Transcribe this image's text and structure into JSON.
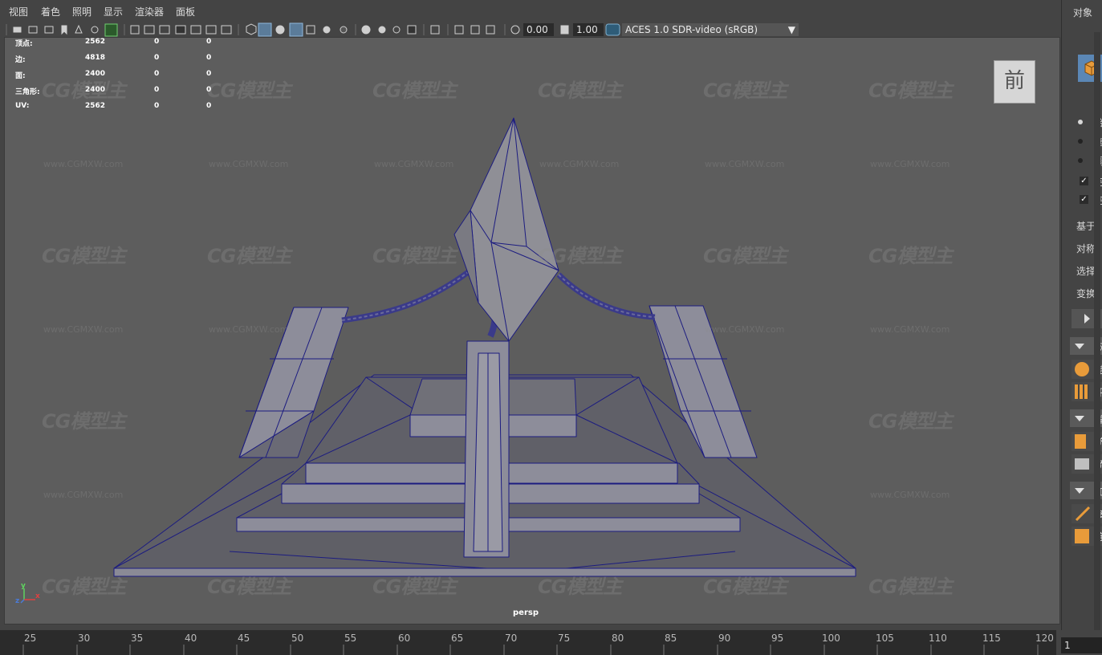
{
  "menu": [
    "视图",
    "着色",
    "照明",
    "显示",
    "渲染器",
    "面板"
  ],
  "toolbar": {
    "exposure_value": "0.00",
    "gamma_value": "1.00",
    "color_space": "ACES 1.0 SDR-video (sRGB)"
  },
  "hud": {
    "rows": [
      {
        "label": "顶点:",
        "v1": "2562",
        "v2": "0",
        "v3": "0"
      },
      {
        "label": "边:",
        "v1": "4818",
        "v2": "0",
        "v3": "0"
      },
      {
        "label": "面:",
        "v1": "2400",
        "v2": "0",
        "v3": "0"
      },
      {
        "label": "三角形:",
        "v1": "2400",
        "v2": "0",
        "v3": "0"
      },
      {
        "label": "UV:",
        "v1": "2562",
        "v2": "0",
        "v3": "0"
      }
    ]
  },
  "viewport": {
    "camera_label": "persp",
    "viewcube_face": "前",
    "axis_labels": {
      "y": "y",
      "x": "x",
      "z": "z"
    },
    "background_color": "#5d5d5d",
    "wire_color": "#1a1a7a",
    "mesh_color": "#8d8d9a"
  },
  "watermark": {
    "logo": "CG模型主",
    "url": "www.CGMXW.com"
  },
  "timeline": {
    "ticks": [
      "25",
      "30",
      "35",
      "40",
      "45",
      "50",
      "55",
      "60",
      "65",
      "70",
      "75",
      "80",
      "85",
      "90",
      "95",
      "100",
      "105",
      "110",
      "115",
      "120"
    ],
    "current_frame": "1"
  },
  "right_panel": {
    "header": "对象",
    "radio_items": [
      "拾",
      "拖",
      "调"
    ],
    "check_items": [
      "完",
      "完"
    ],
    "labels": [
      "基于",
      "对称",
      "选择",
      "变换"
    ],
    "sections": [
      "网",
      "编",
      "工"
    ],
    "tools": [
      "结",
      "平",
      "挤",
      "桥",
      "多",
      "连"
    ]
  }
}
